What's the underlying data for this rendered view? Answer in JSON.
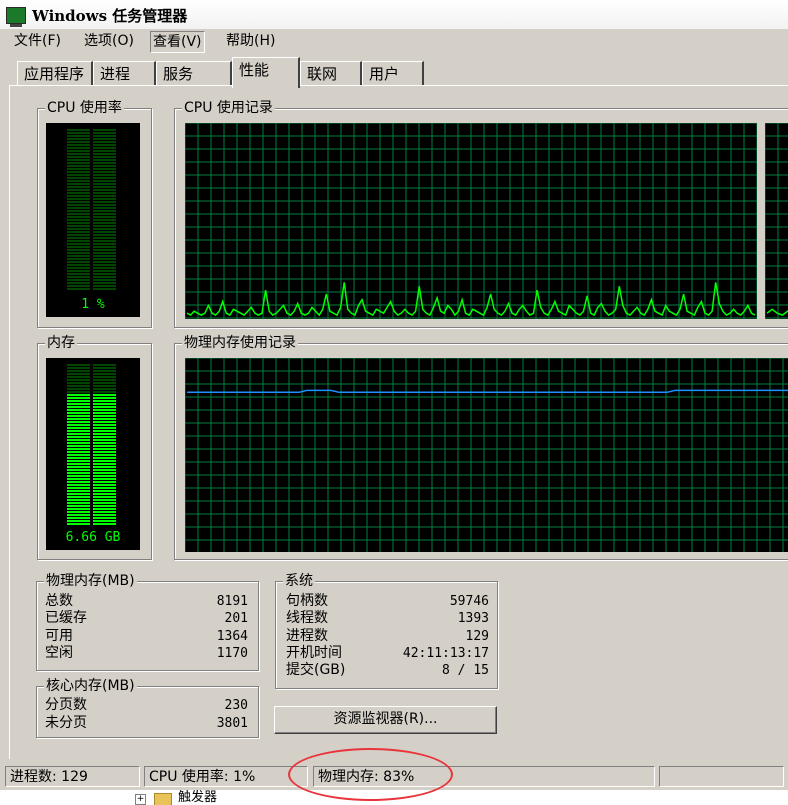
{
  "window": {
    "title": "Windows 任务管理器"
  },
  "menu": [
    {
      "label": "文件(F)"
    },
    {
      "label": "选项(O)"
    },
    {
      "label": "查看(V)"
    },
    {
      "label": "帮助(H)"
    }
  ],
  "tabs": [
    {
      "label": "应用程序"
    },
    {
      "label": "进程"
    },
    {
      "label": "服务"
    },
    {
      "label": "性能",
      "active": true
    },
    {
      "label": "联网"
    },
    {
      "label": "用户"
    }
  ],
  "cpu_usage": {
    "label": "CPU 使用率",
    "value_text": "1 %",
    "percent": 1
  },
  "cpu_history": {
    "label": "CPU 使用记录",
    "samples": [
      2,
      1,
      3,
      2,
      1,
      2,
      6,
      2,
      1,
      3,
      8,
      2,
      1,
      4,
      3,
      2,
      1,
      3,
      5,
      2,
      1,
      2,
      14,
      3,
      1,
      2,
      4,
      6,
      2,
      1,
      3,
      7,
      2,
      1,
      2,
      5,
      3,
      1,
      4,
      12,
      3,
      2,
      1,
      5,
      18,
      4,
      2,
      1,
      6,
      9,
      3,
      2,
      1,
      4,
      3,
      2,
      5,
      8,
      3,
      1,
      2,
      4,
      2,
      1,
      3,
      16,
      4,
      2,
      1,
      5,
      10,
      3,
      2,
      6,
      4,
      1,
      3,
      9,
      2,
      1,
      4,
      3,
      2,
      1,
      5,
      12,
      4,
      2,
      1,
      3,
      7,
      2,
      1,
      4,
      6,
      3,
      1,
      2,
      14,
      5,
      2,
      1,
      4,
      8,
      3,
      2,
      1,
      6,
      4,
      2,
      1,
      3,
      11,
      2,
      1,
      5,
      7,
      3,
      1,
      2,
      4,
      16,
      6,
      2,
      1,
      3,
      5,
      2,
      1,
      4,
      9,
      3,
      2,
      1,
      6,
      3,
      2,
      1,
      4,
      12,
      3,
      2,
      1,
      5,
      8,
      2,
      1,
      3,
      18,
      7,
      3,
      1,
      2,
      4,
      2,
      1,
      3,
      6,
      2,
      1
    ]
  },
  "memory": {
    "label": "内存",
    "value_text": "6.66 GB",
    "percent": 83
  },
  "memory_history": {
    "label": "物理内存使用记录",
    "samples": [
      83,
      83,
      83,
      83,
      83,
      83,
      83,
      83,
      83,
      83,
      83,
      83,
      83,
      83,
      83,
      84,
      84,
      84,
      84,
      83,
      83,
      83,
      83,
      83,
      83,
      83,
      83,
      83,
      83,
      83,
      83,
      83,
      83,
      83,
      83,
      83,
      83,
      83,
      83,
      83,
      83,
      83,
      83,
      83,
      83,
      83,
      83,
      83,
      83,
      83,
      83,
      83,
      83,
      83,
      83,
      83,
      83,
      83,
      83,
      83,
      83,
      84,
      84,
      84,
      84,
      84,
      84,
      84,
      84,
      84,
      84,
      84,
      84,
      84,
      84,
      84,
      84,
      84
    ]
  },
  "physical_memory": {
    "label": "物理内存(MB)",
    "rows": [
      {
        "name": "总数",
        "value": "8191"
      },
      {
        "name": "已缓存",
        "value": "201"
      },
      {
        "name": "可用",
        "value": "1364"
      },
      {
        "name": "空闲",
        "value": "1170"
      }
    ]
  },
  "kernel_memory": {
    "label": "核心内存(MB)",
    "rows": [
      {
        "name": "分页数",
        "value": "230"
      },
      {
        "name": "未分页",
        "value": "3801"
      }
    ]
  },
  "system": {
    "label": "系统",
    "rows": [
      {
        "name": "句柄数",
        "value": "59746"
      },
      {
        "name": "线程数",
        "value": "1393"
      },
      {
        "name": "进程数",
        "value": "129"
      },
      {
        "name": "开机时间",
        "value": "42:11:13:17"
      },
      {
        "name": "提交(GB)",
        "value": "8 / 15"
      }
    ]
  },
  "resource_monitor_button": {
    "label": "资源监视器(R)..."
  },
  "statusbar": {
    "processes": "进程数: 129",
    "cpu": "CPU 使用率: 1%",
    "memory": "物理内存: 83%"
  },
  "below": {
    "folder_label": "触发器"
  },
  "colors": {
    "graph_green": "#00ff00",
    "grid": "#008040",
    "mem_line": "#1e90ff",
    "annotation": "#e8343a"
  }
}
